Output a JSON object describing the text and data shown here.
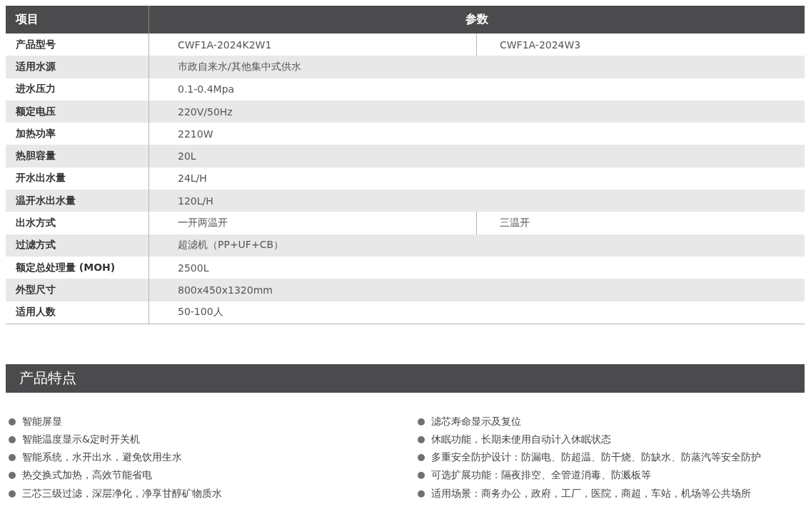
{
  "spec_table": {
    "columns": [
      "项目",
      "参数"
    ],
    "rows": [
      {
        "label": "产品型号",
        "values": [
          "CWF1A-2024K2W1",
          "CWF1A-2024W3"
        ]
      },
      {
        "label": "适用水源",
        "values": [
          "市政自来水/其他集中式供水"
        ]
      },
      {
        "label": "进水压力",
        "values": [
          "0.1-0.4Mpa"
        ]
      },
      {
        "label": "额定电压",
        "values": [
          "220V/50Hz"
        ]
      },
      {
        "label": "加热功率",
        "values": [
          "2210W"
        ]
      },
      {
        "label": "热胆容量",
        "values": [
          "20L"
        ]
      },
      {
        "label": "开水出水量",
        "values": [
          "24L/H"
        ]
      },
      {
        "label": "温开水出水量",
        "values": [
          "120L/H"
        ]
      },
      {
        "label": "出水方式",
        "values": [
          "一开两温开",
          "三温开"
        ]
      },
      {
        "label": "过滤方式",
        "values": [
          "超滤机（PP+UF+CB）"
        ]
      },
      {
        "label": "额定总处理量 (MOH)",
        "values": [
          "2500L"
        ]
      },
      {
        "label": "外型尺寸",
        "values": [
          "800x450x1320mm"
        ]
      },
      {
        "label": "适用人数",
        "values": [
          "50-100人"
        ]
      }
    ]
  },
  "features": {
    "title": "产品特点",
    "columns": [
      [
        "智能屏显",
        "智能温度显示&定时开关机",
        "智能系统，水开出水，避免饮用生水",
        "热交换式加热，高效节能省电",
        "三芯三级过滤，深层净化，净享甘醇矿物质水"
      ],
      [
        "滤芯寿命显示及复位",
        "休眠功能，长期未使用自动计入休眠状态",
        "多重安全防护设计：防漏电、防超温、防干烧、防缺水、防蒸汽等安全防护",
        "可选扩展功能：隔夜排空、全管道消毒、防溅板等",
        "适用场景：商务办公，政府，工厂，医院，商超，车站，机场等公共场所"
      ]
    ]
  }
}
